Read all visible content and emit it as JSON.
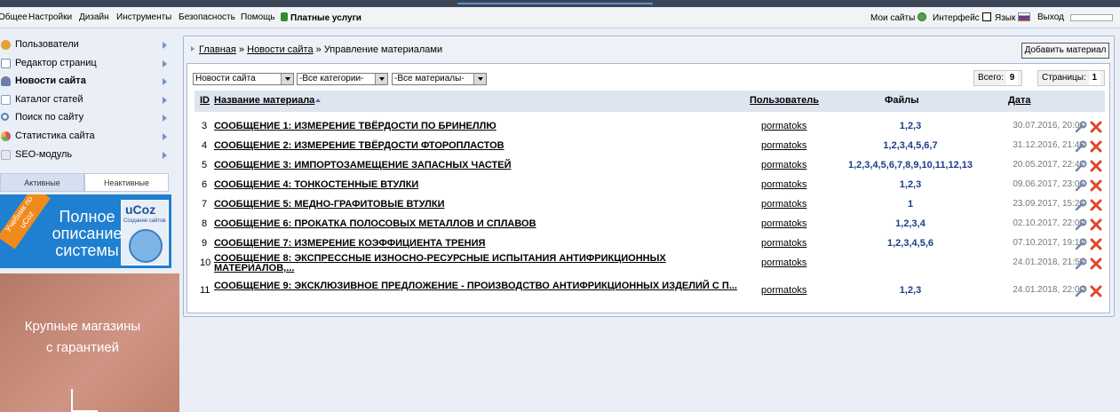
{
  "topbar": {
    "menu": [
      "Общее",
      "Настройки",
      "Дизайн",
      "Инструменты",
      "Безопасность",
      "Помощь"
    ],
    "paid_services": "Платные услуги",
    "right": {
      "my_sites": "Мои сайты",
      "interface": "Интерфейс",
      "language": "Язык",
      "exit": "Выход"
    }
  },
  "sidebar": {
    "items": [
      {
        "label": "Пользователи",
        "icon": "users-icon",
        "color": "#e0a33a"
      },
      {
        "label": "Редактор страниц",
        "icon": "page-editor-icon",
        "color": "#7a8fb0"
      },
      {
        "label": "Новости сайта",
        "icon": "news-icon",
        "color": "#6b7fa8",
        "active": true
      },
      {
        "label": "Каталог статей",
        "icon": "articles-icon",
        "color": "#8aa0c4"
      },
      {
        "label": "Поиск по сайту",
        "icon": "search-icon",
        "color": "#5c7fb8"
      },
      {
        "label": "Статистика сайта",
        "icon": "stats-icon",
        "color": "#d9534f"
      },
      {
        "label": "SEO-модуль",
        "icon": "seo-icon",
        "color": "#c9ced9"
      }
    ],
    "tabs": {
      "active": "Активные",
      "inactive": "Неактивные"
    },
    "banner1": {
      "ribbon": "Учебник по uCoz",
      "text": "Полное описание системы",
      "brand": "uCoz",
      "sub": "Создание сайтов"
    },
    "banner2": {
      "line1": "Крупные магазины",
      "line2": "с гарантией"
    }
  },
  "main": {
    "breadcrumb": {
      "home": "Главная",
      "section": "Новости сайта",
      "sep": "»",
      "current": "Управление материалами"
    },
    "add_button": "Добавить материал",
    "filters": {
      "module": "Новости сайта",
      "category": "-Все категории-",
      "materials": "-Все материалы-"
    },
    "total_label": "Всего:",
    "total": "9",
    "pages_label": "Страницы:",
    "pages": "1",
    "columns": {
      "id": "ID",
      "title": "Название материала",
      "user": "Пользователь",
      "files": "Файлы",
      "date": "Дата"
    },
    "rows": [
      {
        "id": "3",
        "title": "СООБЩЕНИЕ 1: ИЗМЕРЕНИЕ ТВЁРДОСТИ ПО БРИНЕЛЛЮ",
        "user": "pormatoks",
        "files": "1,2,3",
        "date": "30.07.2016, 20:06"
      },
      {
        "id": "4",
        "title": "СООБЩЕНИЕ 2: ИЗМЕРЕНИЕ ТВЁРДОСТИ ФТОРОПЛАСТОВ",
        "user": "pormatoks",
        "files": "1,2,3,4,5,6,7",
        "date": "31.12.2016, 21:43"
      },
      {
        "id": "5",
        "title": "СООБЩЕНИЕ 3: ИМПОРТОЗАМЕЩЕНИЕ ЗАПАСНЫХ ЧАСТЕЙ",
        "user": "pormatoks",
        "files": "1,2,3,4,5,6,7,8,9,10,11,12,13",
        "date": "20.05.2017, 22:42"
      },
      {
        "id": "6",
        "title": "СООБЩЕНИЕ 4: ТОНКОСТЕННЫЕ ВТУЛКИ",
        "user": "pormatoks",
        "files": "1,2,3",
        "date": "09.06.2017, 23:06"
      },
      {
        "id": "7",
        "title": "СООБЩЕНИЕ 5: МЕДНО-ГРАФИТОВЫЕ ВТУЛКИ",
        "user": "pormatoks",
        "files": "1",
        "date": "23.09.2017, 15:26"
      },
      {
        "id": "8",
        "title": "СООБЩЕНИЕ 6: ПРОКАТКА ПОЛОСОВЫХ МЕТАЛЛОВ И СПЛАВОВ",
        "user": "pormatoks",
        "files": "1,2,3,4",
        "date": "02.10.2017, 22:09"
      },
      {
        "id": "9",
        "title": "СООБЩЕНИЕ 7: ИЗМЕРЕНИЕ КОЭФФИЦИЕНТА ТРЕНИЯ",
        "user": "pormatoks",
        "files": "1,2,3,4,5,6",
        "date": "07.10.2017, 19:19"
      },
      {
        "id": "10",
        "title": "СООБЩЕНИЕ 8: ЭКСПРЕССНЫЕ ИЗНОСНО-РЕСУРСНЫЕ ИСПЫТАНИЯ АНТИФРИКЦИОННЫХ МАТЕРИАЛОВ,...",
        "user": "pormatoks",
        "files": "",
        "date": "24.01.2018, 21:58"
      },
      {
        "id": "11",
        "title": "СООБЩЕНИЕ 9: ЭКСКЛЮЗИВНОЕ ПРЕДЛОЖЕНИЕ - ПРОИЗВОДСТВО АНТИФРИКЦИОННЫХ ИЗДЕЛИЙ С П...",
        "user": "pormatoks",
        "files": "1,2,3",
        "date": "24.01.2018, 22:00"
      }
    ]
  },
  "colors": {
    "accent": "#1c3d86",
    "panel": "#eef2f8",
    "header": "#dfe5f0",
    "delete": "#e0452b",
    "edit": "#6f86a8"
  }
}
